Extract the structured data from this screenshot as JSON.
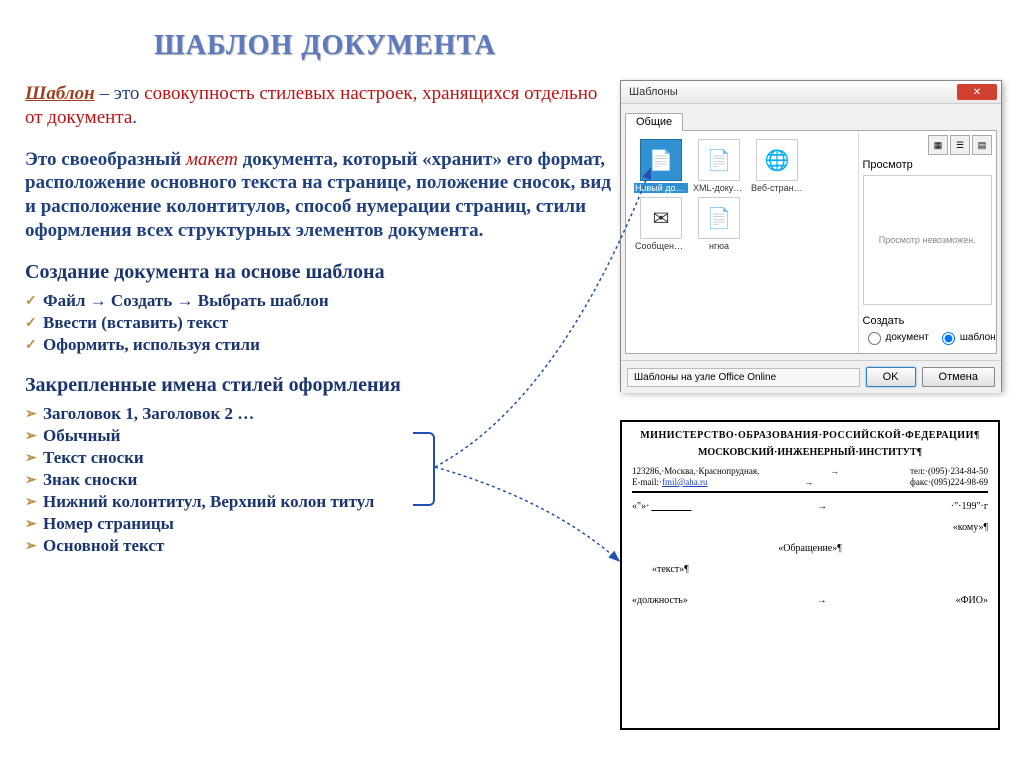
{
  "layout": {
    "title": "ШАБЛОН ДОКУМЕНТА",
    "definition": {
      "term": "Шаблон",
      "intro": " – это ",
      "red1": "совокупность стилевых настроек, хранящихся отдельно от документа",
      "period": ".",
      "para2_a": "Это своеобразный ",
      "para2_b": "макет",
      "para2_c": " документа, который   «хранит» его формат, расположение основного текста на странице, положение сносок, вид и расположение колонтитулов, способ нумерации страниц, стили оформления всех структурных элементов документа."
    },
    "section1": "Создание документа на основе шаблона",
    "steps": [
      "Файл → Создать → Выбрать шаблон",
      "Ввести (вставить) текст",
      "Оформить, используя стили"
    ],
    "section2": "Закрепленные имена стилей оформления",
    "styles": [
      "Заголовок 1, Заголовок 2 …",
      "Обычный",
      "Текст сноски",
      "Знак сноски",
      "Нижний колонтитул, Верхний колон титул",
      "Номер страницы",
      "Основной текст"
    ]
  },
  "dialog": {
    "title": "Шаблоны",
    "tab": "Общие",
    "items": [
      {
        "label": "Новый документ",
        "glyph": "📄",
        "selected": true
      },
      {
        "label": "XML-докум...",
        "glyph": "📄",
        "selected": false
      },
      {
        "label": "Веб-страница",
        "glyph": "🌐",
        "selected": false
      },
      {
        "label": "Сообщение электрон...",
        "glyph": "✉",
        "selected": false
      },
      {
        "label": "нгюа",
        "glyph": "📄",
        "selected": false
      }
    ],
    "preview_label": "Просмотр",
    "preview_text": "Просмотр невозможен.",
    "create_label": "Создать",
    "radio_doc": "документ",
    "radio_tpl": "шаблон",
    "office_link": "Шаблоны на узле Office Online",
    "ok": "OK",
    "cancel": "Отмена"
  },
  "doc": {
    "ministry": "МИНИСТЕРСТВО·ОБРАЗОВАНИЯ·РОССИЙСКОЙ·ФЕДЕРАЦИИ¶",
    "institute": "МОСКОВСКИЙ·ИНЖЕНЕРНЫЙ·ИНСТИТУТ¶",
    "addr": "123286,·Москва,·Краснопрудная,",
    "tel": "тел:·(095)·234-84-50",
    "email_label": "E-mail:·",
    "email": "fmil@aha.ru",
    "fax": "факс·(095)224-98-69",
    "date_left": "«\"»·",
    "date_right": "·\"·199\"·г",
    "komu": "«кому»¶",
    "obr": "«Обращение»¶",
    "text": "«текст»¶",
    "dolzh": "«должность»",
    "fio": "«ФИО»"
  }
}
